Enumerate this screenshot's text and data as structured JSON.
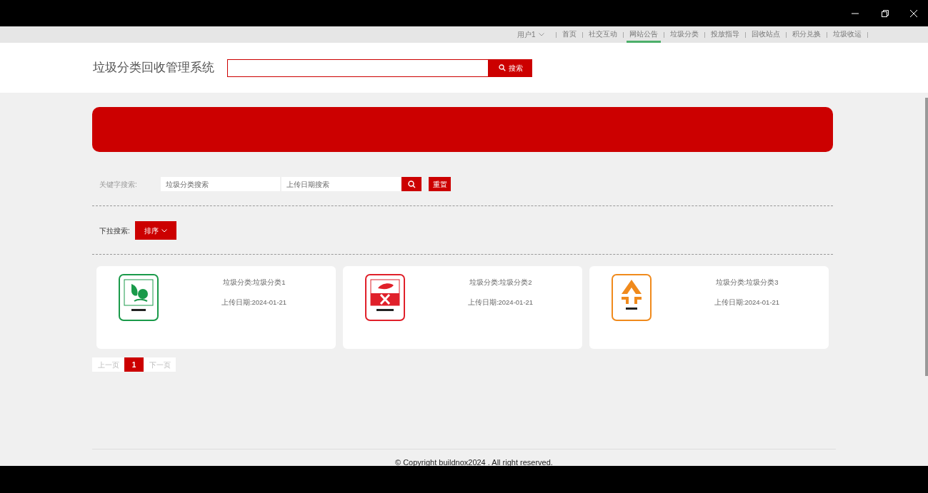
{
  "nav": {
    "user": "用户1",
    "items": [
      {
        "label": "首页",
        "selected": false
      },
      {
        "label": "社交互动",
        "selected": false
      },
      {
        "label": "网站公告",
        "selected": true
      },
      {
        "label": "垃圾分类",
        "selected": false
      },
      {
        "label": "投放指导",
        "selected": false
      },
      {
        "label": "回收站点",
        "selected": false
      },
      {
        "label": "积分兑换",
        "selected": false
      },
      {
        "label": "垃圾收运",
        "selected": false
      }
    ]
  },
  "header": {
    "title": "垃圾分类回收管理系统",
    "search_button": "搜索"
  },
  "filters": {
    "label": "关键字搜索:",
    "fields": [
      {
        "placeholder": "垃圾分类搜索"
      },
      {
        "placeholder": "上传日期搜索"
      }
    ],
    "reset_button": "重置",
    "dropdown_label": "下拉搜索:",
    "sort_button": "排序"
  },
  "cards": [
    {
      "kind": "wet",
      "name": "垃圾分类:垃圾分类1",
      "date": "上传日期:2024-01-21"
    },
    {
      "kind": "hazardous",
      "name": "垃圾分类:垃圾分类2",
      "date": "上传日期:2024-01-21"
    },
    {
      "kind": "dry",
      "name": "垃圾分类:垃圾分类3",
      "date": "上传日期:2024-01-21"
    }
  ],
  "pagination": {
    "prev": "上一页",
    "pages": [
      {
        "label": "1",
        "selected": true
      }
    ],
    "next": "下一页"
  },
  "footer": "© Copyright buildnox2024 . All right reserved."
}
